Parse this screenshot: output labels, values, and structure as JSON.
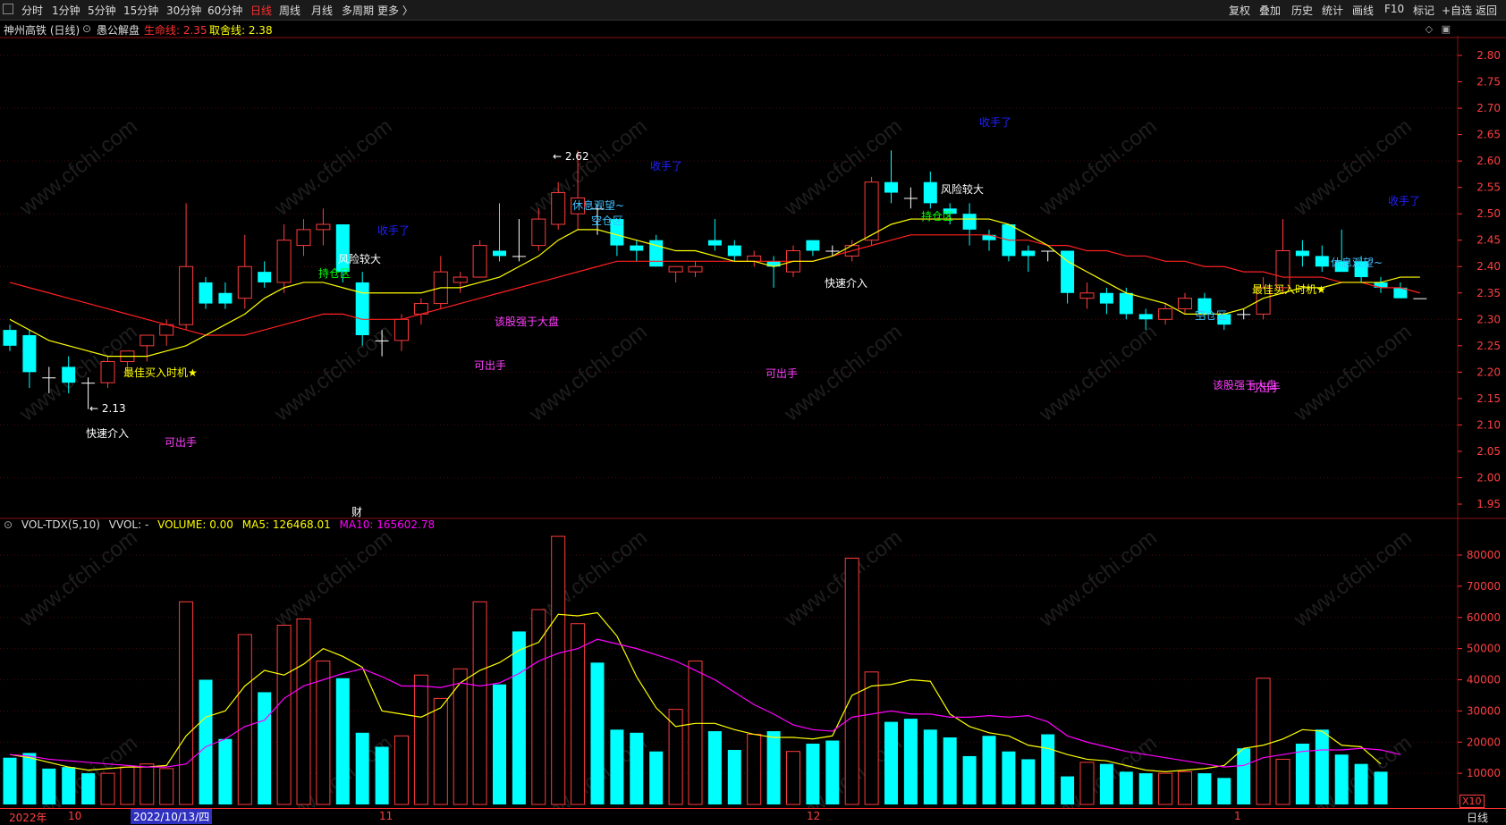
{
  "toolbar": {
    "left_items": [
      "分时",
      "1分钟",
      "5分钟",
      "15分钟",
      "30分钟",
      "60分钟",
      "日线",
      "周线",
      "月线",
      "多周期",
      "更多 〉"
    ],
    "active": "日线",
    "right_items": [
      "复权",
      "叠加",
      "历史",
      "统计",
      "画线",
      "F10",
      "标记",
      "+自选",
      "返回"
    ]
  },
  "title": {
    "stock": "神州高铁 (日线)",
    "indicator": "愚公解盘",
    "life_line_label": "生命线: 2.35",
    "sell_line_label": "取舍线: 2.38"
  },
  "price_axis": [
    "2.80",
    "2.75",
    "2.70",
    "2.65",
    "2.60",
    "2.55",
    "2.50",
    "2.45",
    "2.40",
    "2.35",
    "2.30",
    "2.25",
    "2.20",
    "2.15",
    "2.10",
    "2.05",
    "2.00",
    "1.95"
  ],
  "volume_header": {
    "name": "VOL-TDX(5,10)",
    "vvol": "VVOL: -",
    "volume": "VOLUME: 0.00",
    "ma5": "MA5: 126468.01",
    "ma10": "MA10: 165602.78"
  },
  "volume_axis": [
    "80000",
    "70000",
    "60000",
    "50000",
    "40000",
    "30000",
    "20000",
    "10000"
  ],
  "volume_scale": "X10",
  "dates": {
    "year": "2022年",
    "oct": "10",
    "selected": "2022/10/13/四",
    "nov": "11",
    "dec": "12",
    "jan": "1"
  },
  "period": "日线",
  "annotations": {
    "high_price": "2.62",
    "low_price": "2.13",
    "best_buy": "最佳买入时机★",
    "fast_in": "快速介入",
    "can_sell": "可出手",
    "close_hand": "收手了",
    "high_risk": "风险较大",
    "hold_zone": "持仓区",
    "empty_zone": "空仓区",
    "rest_watch": "休息观望~",
    "strong": "该股强于大盘",
    "finance": "财"
  },
  "watermark": "www.cfchi.com",
  "colors": {
    "up": "#ff3c3c",
    "down": "#00ffff",
    "ma_life": "#ff2020",
    "ma_sell": "#ffff00",
    "ma10": "#ff00ff",
    "bg": "#000000"
  },
  "chart_data": {
    "type": "candlestick",
    "price_range": [
      1.93,
      2.83
    ],
    "volume_range": [
      0,
      88000
    ],
    "candles": [
      [
        2.28,
        2.29,
        2.24,
        2.25
      ],
      [
        2.27,
        2.28,
        2.17,
        2.2
      ],
      [
        2.19,
        2.21,
        2.16,
        2.19
      ],
      [
        2.21,
        2.23,
        2.16,
        2.18
      ],
      [
        2.18,
        2.19,
        2.13,
        2.18
      ],
      [
        2.18,
        2.23,
        2.17,
        2.22
      ],
      [
        2.22,
        2.24,
        2.2,
        2.24
      ],
      [
        2.25,
        2.27,
        2.22,
        2.27
      ],
      [
        2.27,
        2.3,
        2.25,
        2.29
      ],
      [
        2.29,
        2.52,
        2.28,
        2.4
      ],
      [
        2.37,
        2.38,
        2.32,
        2.33
      ],
      [
        2.35,
        2.37,
        2.32,
        2.33
      ],
      [
        2.34,
        2.46,
        2.32,
        2.4
      ],
      [
        2.39,
        2.41,
        2.36,
        2.37
      ],
      [
        2.37,
        2.48,
        2.35,
        2.45
      ],
      [
        2.44,
        2.49,
        2.42,
        2.47
      ],
      [
        2.47,
        2.51,
        2.44,
        2.48
      ],
      [
        2.48,
        2.48,
        2.37,
        2.39
      ],
      [
        2.37,
        2.39,
        2.25,
        2.27
      ],
      [
        2.26,
        2.28,
        2.23,
        2.26
      ],
      [
        2.26,
        2.31,
        2.24,
        2.3
      ],
      [
        2.31,
        2.34,
        2.29,
        2.33
      ],
      [
        2.33,
        2.42,
        2.32,
        2.39
      ],
      [
        2.37,
        2.39,
        2.35,
        2.38
      ],
      [
        2.38,
        2.45,
        2.38,
        2.44
      ],
      [
        2.43,
        2.52,
        2.41,
        2.42
      ],
      [
        2.42,
        2.49,
        2.41,
        2.42
      ],
      [
        2.44,
        2.51,
        2.43,
        2.49
      ],
      [
        2.48,
        2.56,
        2.47,
        2.54
      ],
      [
        2.5,
        2.62,
        2.47,
        2.53
      ],
      [
        2.51,
        2.52,
        2.46,
        2.51
      ],
      [
        2.49,
        2.49,
        2.42,
        2.44
      ],
      [
        2.44,
        2.45,
        2.41,
        2.43
      ],
      [
        2.45,
        2.46,
        2.4,
        2.4
      ],
      [
        2.39,
        2.4,
        2.37,
        2.4
      ],
      [
        2.39,
        2.41,
        2.38,
        2.4
      ],
      [
        2.45,
        2.49,
        2.43,
        2.44
      ],
      [
        2.44,
        2.45,
        2.41,
        2.42
      ],
      [
        2.41,
        2.43,
        2.4,
        2.42
      ],
      [
        2.41,
        2.42,
        2.36,
        2.4
      ],
      [
        2.39,
        2.44,
        2.38,
        2.43
      ],
      [
        2.45,
        2.45,
        2.42,
        2.43
      ],
      [
        2.43,
        2.44,
        2.42,
        2.43
      ],
      [
        2.42,
        2.45,
        2.41,
        2.44
      ],
      [
        2.45,
        2.57,
        2.44,
        2.56
      ],
      [
        2.56,
        2.62,
        2.52,
        2.54
      ],
      [
        2.53,
        2.55,
        2.51,
        2.53
      ],
      [
        2.56,
        2.58,
        2.51,
        2.52
      ],
      [
        2.51,
        2.52,
        2.48,
        2.5
      ],
      [
        2.5,
        2.52,
        2.44,
        2.47
      ],
      [
        2.46,
        2.47,
        2.43,
        2.45
      ],
      [
        2.48,
        2.48,
        2.41,
        2.42
      ],
      [
        2.43,
        2.44,
        2.39,
        2.42
      ],
      [
        2.43,
        2.43,
        2.41,
        2.43
      ],
      [
        2.43,
        2.43,
        2.33,
        2.35
      ],
      [
        2.34,
        2.37,
        2.32,
        2.35
      ],
      [
        2.35,
        2.36,
        2.31,
        2.33
      ],
      [
        2.35,
        2.36,
        2.3,
        2.31
      ],
      [
        2.31,
        2.32,
        2.28,
        2.3
      ],
      [
        2.3,
        2.33,
        2.29,
        2.32
      ],
      [
        2.32,
        2.35,
        2.31,
        2.34
      ],
      [
        2.34,
        2.35,
        2.3,
        2.31
      ],
      [
        2.31,
        2.31,
        2.28,
        2.29
      ],
      [
        2.31,
        2.32,
        2.3,
        2.31
      ],
      [
        2.31,
        2.38,
        2.3,
        2.36
      ],
      [
        2.36,
        2.49,
        2.35,
        2.43
      ],
      [
        2.43,
        2.45,
        2.4,
        2.42
      ],
      [
        2.42,
        2.44,
        2.39,
        2.4
      ],
      [
        2.41,
        2.47,
        2.39,
        2.39
      ],
      [
        2.41,
        2.42,
        2.37,
        2.38
      ],
      [
        2.37,
        2.38,
        2.35,
        2.36
      ],
      [
        2.36,
        2.37,
        2.34,
        2.34
      ],
      [
        2.34,
        2.34,
        2.34,
        2.34
      ]
    ],
    "volume": [
      15000,
      16500,
      11500,
      12000,
      10000,
      10000,
      12000,
      13000,
      11500,
      65000,
      40000,
      21000,
      54500,
      36000,
      57500,
      59500,
      46000,
      40500,
      23000,
      18500,
      22000,
      41500,
      34000,
      43500,
      65000,
      38500,
      55500,
      62500,
      86000,
      58000,
      45500,
      24000,
      23000,
      17000,
      30500,
      46000,
      23500,
      17500,
      22500,
      23500,
      17000,
      19500,
      20500,
      79000,
      42500,
      26500,
      27500,
      24000,
      21500,
      15500,
      22000,
      17000,
      14500,
      22500,
      9000,
      13500,
      13000,
      10500,
      10000,
      10000,
      10500,
      10000,
      8500,
      18000,
      40500,
      14500,
      19500,
      24000,
      16000,
      13000,
      10500,
      0,
      0
    ],
    "life_line": [
      2.37,
      2.36,
      2.35,
      2.34,
      2.33,
      2.32,
      2.31,
      2.3,
      2.29,
      2.28,
      2.27,
      2.27,
      2.27,
      2.28,
      2.29,
      2.3,
      2.31,
      2.31,
      2.3,
      2.3,
      2.3,
      2.31,
      2.32,
      2.33,
      2.34,
      2.35,
      2.36,
      2.37,
      2.38,
      2.39,
      2.4,
      2.41,
      2.41,
      2.41,
      2.41,
      2.41,
      2.41,
      2.41,
      2.41,
      2.41,
      2.41,
      2.41,
      2.42,
      2.43,
      2.44,
      2.45,
      2.46,
      2.46,
      2.46,
      2.46,
      2.46,
      2.45,
      2.45,
      2.44,
      2.44,
      2.43,
      2.43,
      2.42,
      2.42,
      2.41,
      2.41,
      2.4,
      2.4,
      2.39,
      2.39,
      2.38,
      2.38,
      2.38,
      2.37,
      2.37,
      2.36,
      2.36,
      2.35
    ],
    "sell_line": [
      2.3,
      2.28,
      2.26,
      2.25,
      2.24,
      2.23,
      2.23,
      2.23,
      2.24,
      2.25,
      2.27,
      2.29,
      2.31,
      2.34,
      2.36,
      2.37,
      2.37,
      2.36,
      2.35,
      2.35,
      2.35,
      2.35,
      2.36,
      2.36,
      2.37,
      2.38,
      2.4,
      2.42,
      2.45,
      2.47,
      2.47,
      2.46,
      2.45,
      2.44,
      2.43,
      2.43,
      2.42,
      2.41,
      2.41,
      2.4,
      2.41,
      2.41,
      2.42,
      2.44,
      2.46,
      2.48,
      2.49,
      2.49,
      2.49,
      2.49,
      2.49,
      2.48,
      2.46,
      2.44,
      2.41,
      2.39,
      2.37,
      2.35,
      2.34,
      2.33,
      2.31,
      2.31,
      2.31,
      2.32,
      2.34,
      2.35,
      2.36,
      2.36,
      2.37,
      2.37,
      2.37,
      2.38,
      2.38
    ],
    "vol_ma5": [
      16000,
      15000,
      13500,
      12000,
      11000,
      11500,
      12000,
      12000,
      12500,
      22000,
      28000,
      30000,
      38000,
      43000,
      41500,
      45000,
      50000,
      47500,
      44000,
      30000,
      29000,
      28000,
      31000,
      39000,
      43000,
      45500,
      49500,
      52000,
      61000,
      60500,
      61500,
      54000,
      41000,
      31000,
      25000,
      26000,
      26000,
      24000,
      22500,
      21500,
      21500,
      21000,
      22000,
      35000,
      38000,
      38500,
      40000,
      39500,
      29000,
      25000,
      23000,
      22000,
      19000,
      18000,
      16000,
      14500,
      14000,
      12500,
      11000,
      10500,
      11000,
      11500,
      12500,
      18000,
      19000,
      21000,
      24000,
      23500,
      19000,
      18500,
      13000,
      0,
      0
    ],
    "vol_ma10": [
      16000,
      15500,
      14500,
      14000,
      13500,
      13000,
      12500,
      12000,
      12000,
      13000,
      18500,
      21000,
      25000,
      27000,
      34000,
      38000,
      40000,
      42000,
      43500,
      41000,
      38000,
      38000,
      37500,
      39000,
      38000,
      39000,
      42000,
      46000,
      48500,
      50000,
      53000,
      51500,
      50000,
      48000,
      46000,
      43000,
      40000,
      36000,
      32000,
      29000,
      25500,
      24000,
      23500,
      28000,
      29000,
      30000,
      29000,
      29000,
      28000,
      28000,
      28500,
      28000,
      28500,
      26500,
      22000,
      20000,
      18500,
      17000,
      16000,
      15000,
      14000,
      13000,
      12000,
      12500,
      15000,
      16000,
      17000,
      17500,
      17500,
      18000,
      17500,
      16000,
      0
    ]
  }
}
